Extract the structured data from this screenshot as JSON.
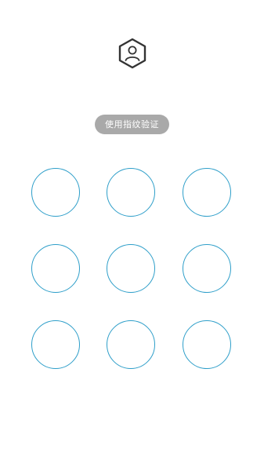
{
  "header": {
    "avatar_icon": "user-hexagon-icon",
    "icon_color": "#333333"
  },
  "fingerprint_button": {
    "label": "使用指纹验证",
    "bg_color": "#a9a9a9",
    "text_color": "#ffffff"
  },
  "pattern_lock": {
    "ring_color": "#2d9ec9",
    "dots": [
      {
        "id": 1
      },
      {
        "id": 2
      },
      {
        "id": 3
      },
      {
        "id": 4
      },
      {
        "id": 5
      },
      {
        "id": 6
      },
      {
        "id": 7
      },
      {
        "id": 8
      },
      {
        "id": 9
      }
    ]
  }
}
